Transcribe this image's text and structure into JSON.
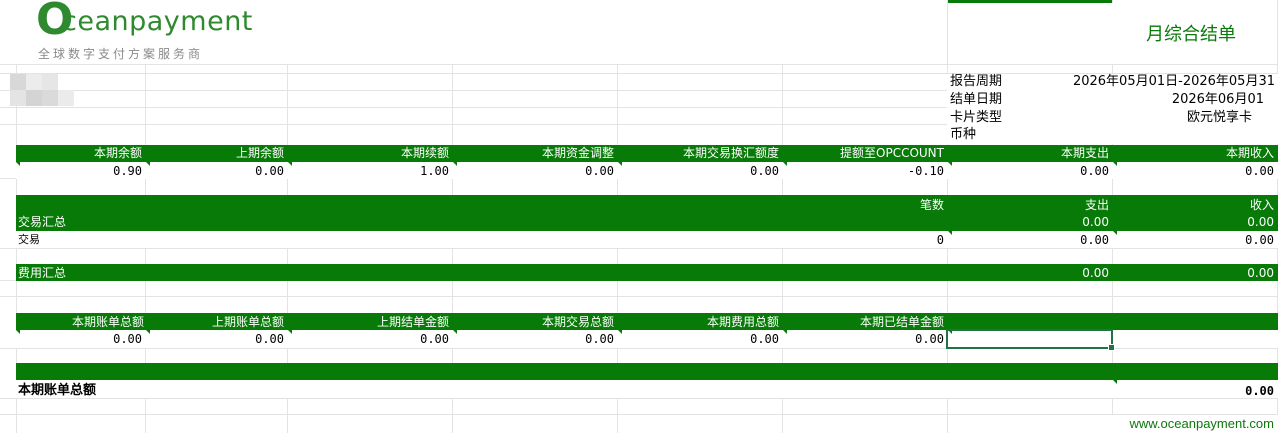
{
  "logo": {
    "initial": "O",
    "wordmark": "ceanpayment",
    "tagline": "全球数字支付方案服务商"
  },
  "statement_title": "月综合结单",
  "info": {
    "report_period_label": "报告周期",
    "report_period_value": "2026年05月01日-2026年05月31",
    "statement_date_label": "结单日期",
    "statement_date_value": "2026年06月01",
    "card_type_label": "卡片类型",
    "card_type_value": "欧元悦享卡",
    "currency_label": "币种"
  },
  "balance_table": {
    "headers": [
      "本期余额",
      "上期余额",
      "本期续额",
      "本期资金调整",
      "本期交易换汇额度",
      "提额至OPCCOUNT",
      "本期支出",
      "本期收入"
    ],
    "values": [
      "0.90",
      "0.00",
      "1.00",
      "0.00",
      "0.00",
      "-0.10",
      "0.00",
      "0.00"
    ]
  },
  "transaction_summary": {
    "title": "交易汇总",
    "count_header": "笔数",
    "expense_header": "支出",
    "income_header": "收入",
    "header_expense_total": "0.00",
    "header_income_total": "0.00",
    "row_label": "交易",
    "row_count": "0",
    "row_expense": "0.00",
    "row_income": "0.00"
  },
  "fee_summary": {
    "title": "费用汇总",
    "expense": "0.00",
    "income": "0.00"
  },
  "bill_table": {
    "headers": [
      "本期账单总额",
      "上期账单总额",
      "上期结单金额",
      "本期交易总额",
      "本期费用总额",
      "本期已结单金额"
    ],
    "values": [
      "0.00",
      "0.00",
      "0.00",
      "0.00",
      "0.00",
      "0.00"
    ]
  },
  "total": {
    "label": "本期账单总额",
    "value": "0.00"
  },
  "footer_url": "www.oceanpayment.com",
  "colors": {
    "band_green": "#087a08",
    "logo_green": "#2f8a2f",
    "title_green": "#0a7a0a",
    "url_green": "#0a7a0a"
  }
}
